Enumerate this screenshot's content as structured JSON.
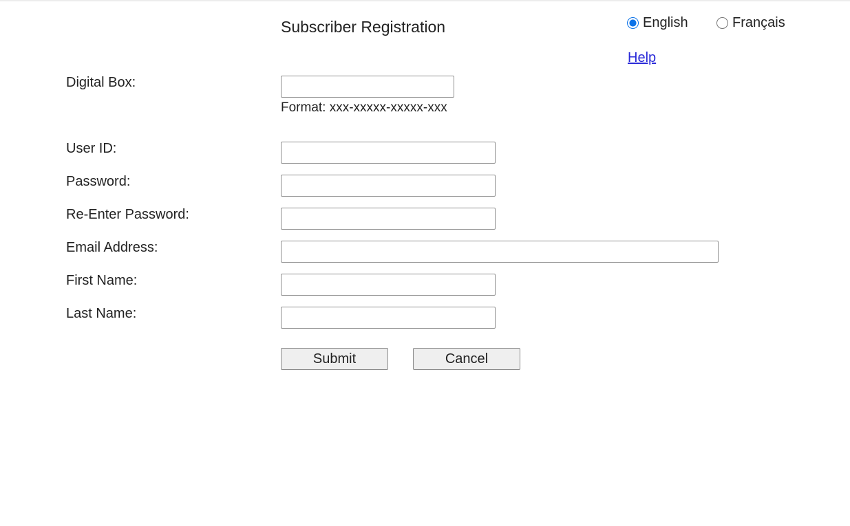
{
  "header": {
    "title": "Subscriber Registration"
  },
  "language": {
    "options": [
      {
        "label": "English",
        "selected": true
      },
      {
        "label": "Français",
        "selected": false
      }
    ]
  },
  "help_link": "Help",
  "form": {
    "digital_box": {
      "label": "Digital Box:",
      "value": "",
      "hint": "Format: xxx-xxxxx-xxxxx-xxx"
    },
    "user_id": {
      "label": "User ID:",
      "value": ""
    },
    "password": {
      "label": "Password:",
      "value": ""
    },
    "reenter_password": {
      "label": "Re-Enter Password:",
      "value": ""
    },
    "email": {
      "label": "Email Address:",
      "value": ""
    },
    "first_name": {
      "label": "First Name:",
      "value": ""
    },
    "last_name": {
      "label": "Last Name:",
      "value": ""
    }
  },
  "buttons": {
    "submit": "Submit",
    "cancel": "Cancel"
  },
  "colors": {
    "link": "#2a2ad8",
    "radio_accent": "#0b72e8"
  }
}
